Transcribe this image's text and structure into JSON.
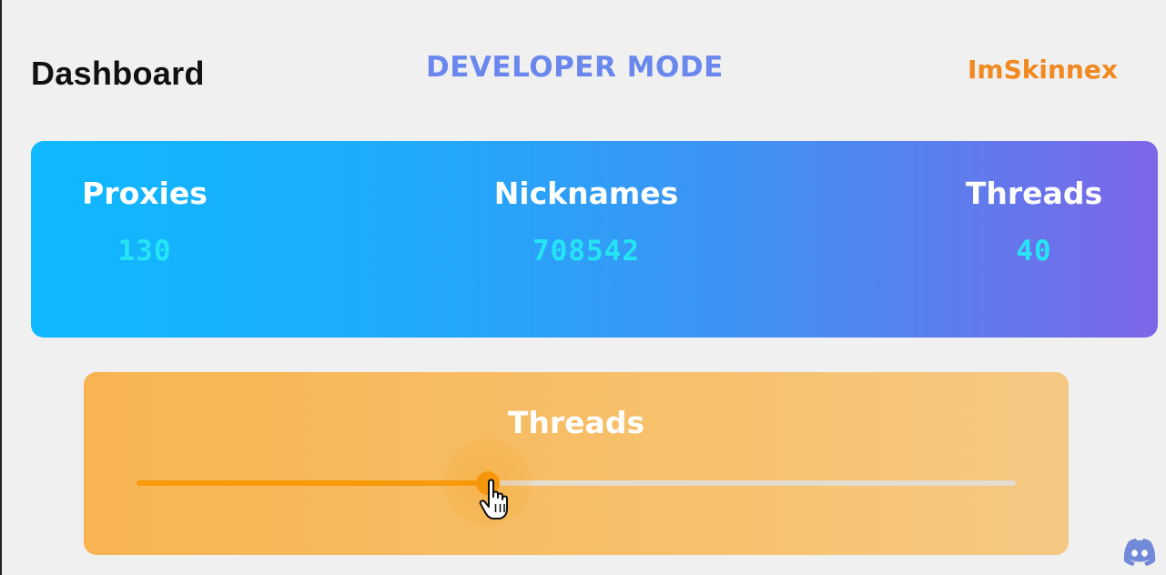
{
  "header": {
    "title": "Dashboard",
    "mode": "DEVELOPER MODE",
    "username": "ImSkinnex"
  },
  "stats": {
    "proxies": {
      "label": "Proxies",
      "value": "130"
    },
    "nicknames": {
      "label": "Nicknames",
      "value": "708542"
    },
    "threads": {
      "label": "Threads",
      "value": "40"
    }
  },
  "threads_slider": {
    "label": "Threads",
    "fraction": 0.4
  },
  "colors": {
    "mode_text": "#6a87ee",
    "username_text": "#f0891f",
    "stat_value_text": "#25e5f5",
    "stats_gradient_start": "#0fb9ff",
    "stats_gradient_end": "#7e66e8",
    "slider_card": "#f7be66",
    "slider_active": "#f79a0c"
  },
  "icons": {
    "cursor": "hand-pointer-icon",
    "discord": "discord-icon"
  }
}
